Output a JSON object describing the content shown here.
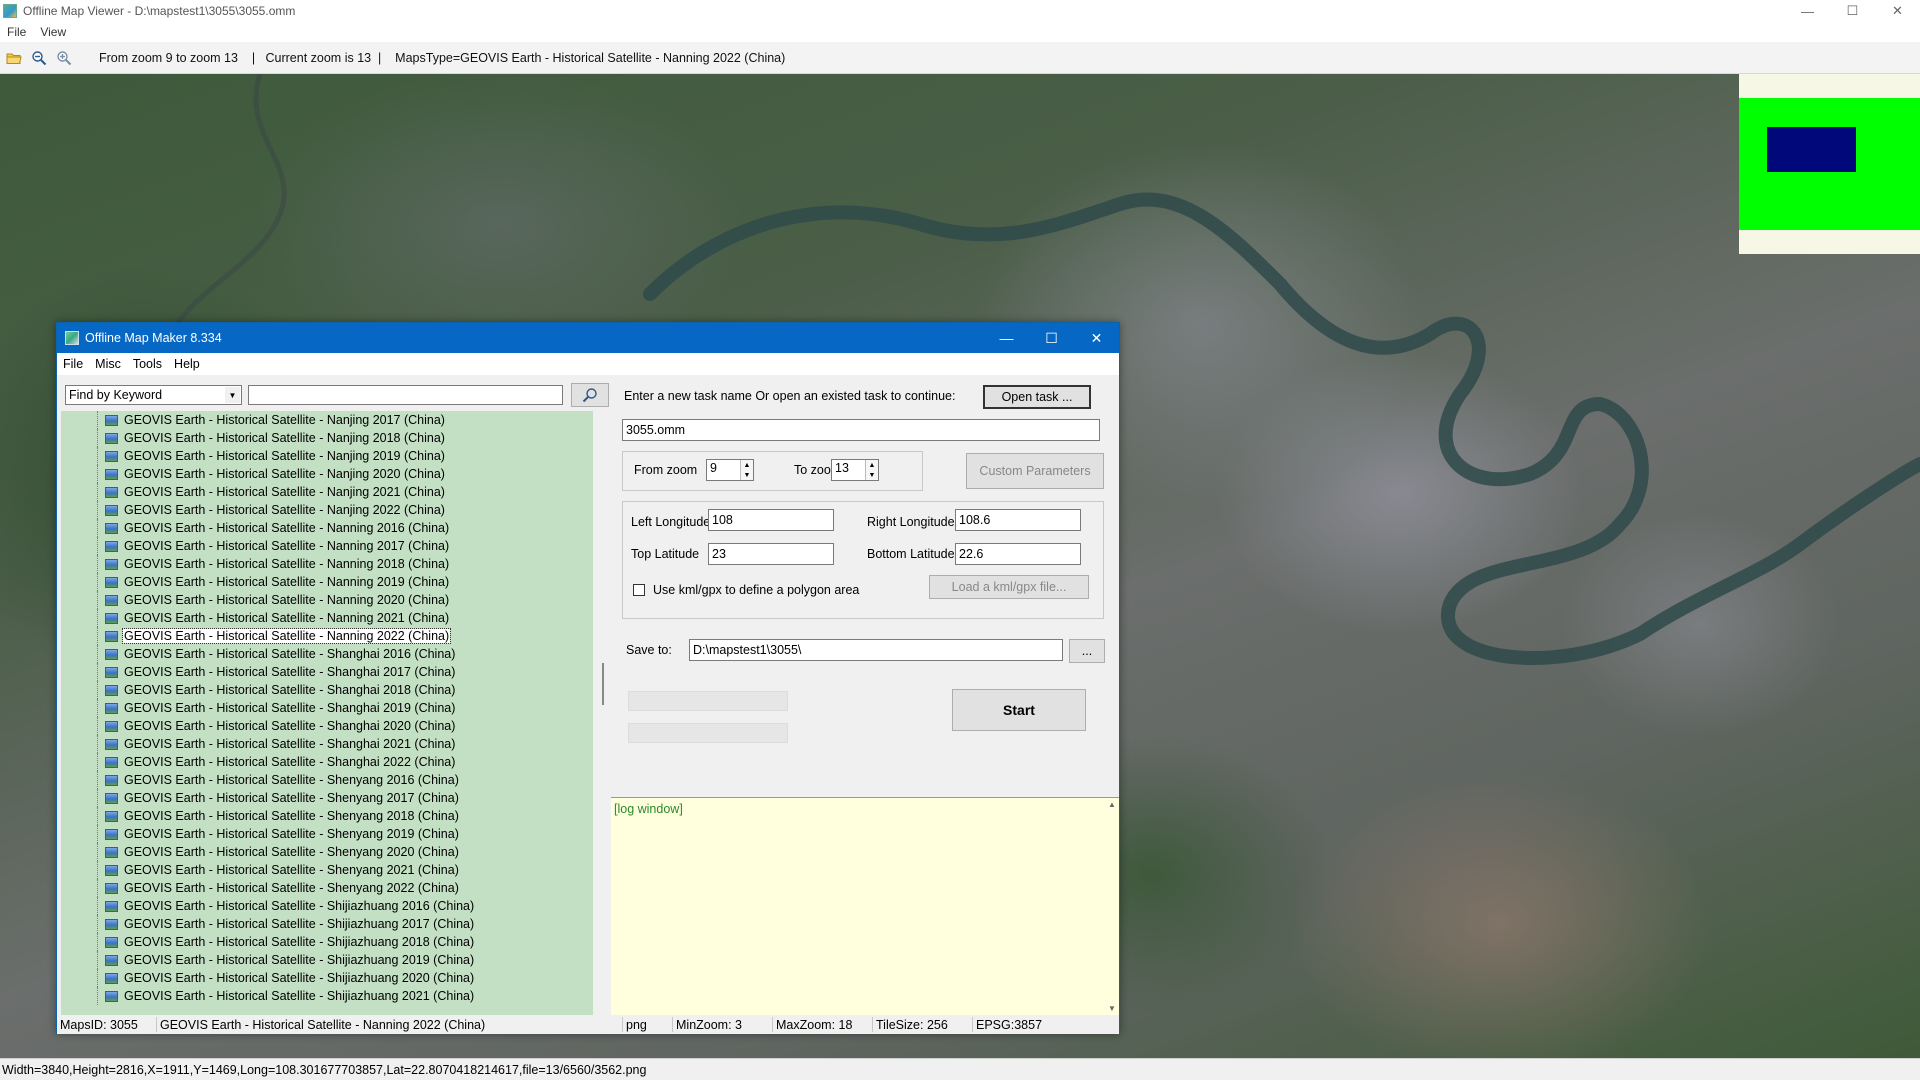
{
  "window": {
    "title": "Offline Map Viewer - D:\\mapstest1\\3055\\3055.omm",
    "controls": {
      "minimize": "—",
      "maximize": "☐",
      "close": "✕"
    }
  },
  "menu": {
    "file": "File",
    "view": "View"
  },
  "toolbar": {
    "icons": [
      "open-folder-icon",
      "zoom-out-icon",
      "zoom-in-icon"
    ],
    "info": "From zoom 9 to zoom 13    |   Current zoom is 13  |    MapsType=GEOVIS Earth - Historical Satellite - Nanning 2022 (China)"
  },
  "status_bar": {
    "text": "Width=3840,Height=2816,X=1911,Y=1469,Long=108.301677703857,Lat=22.8070418214617,file=13/6560/3562.png"
  },
  "minimap": {
    "background": "#f7f7e6",
    "area_color": "#00ff00",
    "viewport_color": "#00087a"
  },
  "dialog": {
    "title": "Offline Map Maker 8.334",
    "menu": {
      "file": "File",
      "misc": "Misc",
      "tools": "Tools",
      "help": "Help"
    },
    "find": {
      "mode": "Find by Keyword",
      "keyword": ""
    },
    "tree_items": [
      "GEOVIS Earth - Historical Satellite - Nanjing 2017 (China)",
      "GEOVIS Earth - Historical Satellite - Nanjing 2018 (China)",
      "GEOVIS Earth - Historical Satellite - Nanjing 2019 (China)",
      "GEOVIS Earth - Historical Satellite - Nanjing 2020 (China)",
      "GEOVIS Earth - Historical Satellite - Nanjing 2021 (China)",
      "GEOVIS Earth - Historical Satellite - Nanjing 2022 (China)",
      "GEOVIS Earth - Historical Satellite - Nanning 2016 (China)",
      "GEOVIS Earth - Historical Satellite - Nanning 2017 (China)",
      "GEOVIS Earth - Historical Satellite - Nanning 2018 (China)",
      "GEOVIS Earth - Historical Satellite - Nanning 2019 (China)",
      "GEOVIS Earth - Historical Satellite - Nanning 2020 (China)",
      "GEOVIS Earth - Historical Satellite - Nanning 2021 (China)",
      "GEOVIS Earth - Historical Satellite - Nanning 2022 (China)",
      "GEOVIS Earth - Historical Satellite - Shanghai 2016 (China)",
      "GEOVIS Earth - Historical Satellite - Shanghai 2017 (China)",
      "GEOVIS Earth - Historical Satellite - Shanghai 2018 (China)",
      "GEOVIS Earth - Historical Satellite - Shanghai 2019 (China)",
      "GEOVIS Earth - Historical Satellite - Shanghai 2020 (China)",
      "GEOVIS Earth - Historical Satellite - Shanghai 2021 (China)",
      "GEOVIS Earth - Historical Satellite - Shanghai 2022 (China)",
      "GEOVIS Earth - Historical Satellite - Shenyang 2016 (China)",
      "GEOVIS Earth - Historical Satellite - Shenyang 2017 (China)",
      "GEOVIS Earth - Historical Satellite - Shenyang 2018 (China)",
      "GEOVIS Earth - Historical Satellite - Shenyang 2019 (China)",
      "GEOVIS Earth - Historical Satellite - Shenyang 2020 (China)",
      "GEOVIS Earth - Historical Satellite - Shenyang 2021 (China)",
      "GEOVIS Earth - Historical Satellite - Shenyang 2022 (China)",
      "GEOVIS Earth - Historical Satellite - Shijiazhuang 2016 (China)",
      "GEOVIS Earth - Historical Satellite - Shijiazhuang 2017 (China)",
      "GEOVIS Earth - Historical Satellite - Shijiazhuang 2018 (China)",
      "GEOVIS Earth - Historical Satellite - Shijiazhuang 2019 (China)",
      "GEOVIS Earth - Historical Satellite - Shijiazhuang 2020 (China)",
      "GEOVIS Earth - Historical Satellite - Shijiazhuang 2021 (China)"
    ],
    "selected_item": "GEOVIS Earth - Historical Satellite - Nanning 2022 (China)",
    "task": {
      "prompt": "Enter a new task name Or open an existed task to continue:",
      "open_button": "Open task ...",
      "name": "3055.omm"
    },
    "zoom": {
      "from_label": "From zoom",
      "from_value": "9",
      "to_label": "To zoom",
      "to_value": "13",
      "custom_button": "Custom Parameters"
    },
    "bounds": {
      "left_label": "Left Longitude",
      "left_value": "108",
      "right_label": "Right Longitude",
      "right_value": "108.6",
      "top_label": "Top Latitude",
      "top_value": "23",
      "bottom_label": "Bottom Latitude",
      "bottom_value": "22.6",
      "kml_label": "Use kml/gpx to define a polygon area",
      "kml_checked": false,
      "load_button": "Load a kml/gpx file..."
    },
    "save": {
      "label": "Save to:",
      "path": "D:\\mapstest1\\3055\\",
      "browse": "..."
    },
    "start_button": "Start",
    "log": "[log window]",
    "status": {
      "maps_id": "MapsID: 3055",
      "map_name": "GEOVIS Earth - Historical Satellite - Nanning 2022 (China)",
      "format": "png",
      "min_zoom": "MinZoom: 3",
      "max_zoom": "MaxZoom: 18",
      "tile_size": "TileSize: 256",
      "epsg": "EPSG:3857"
    }
  }
}
